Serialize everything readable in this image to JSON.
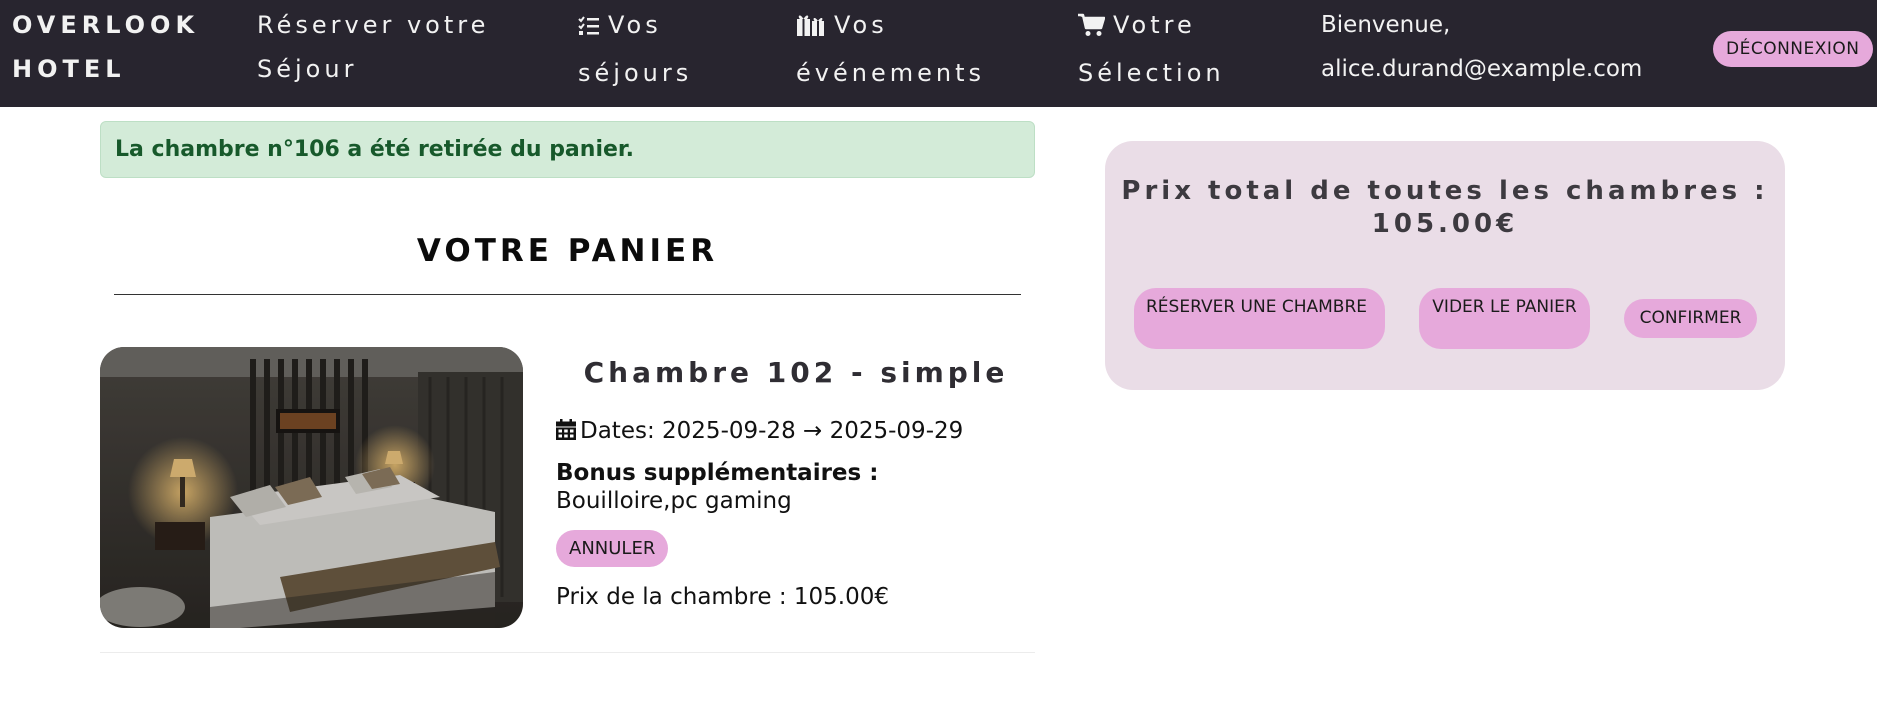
{
  "navbar": {
    "brand": {
      "line1": "OVERLOOK",
      "line2": "HOTEL"
    },
    "reserve": {
      "line1": "Réserver votre",
      "line2": "Séjour"
    },
    "stays": {
      "icon": "checklist-icon",
      "line1": "Vos",
      "line2": "séjours"
    },
    "events": {
      "icon": "gift-icon",
      "line1": "Vos",
      "line2": "événements"
    },
    "selection": {
      "icon": "cart-icon",
      "line1": "Votre",
      "line2": "Sélection"
    },
    "welcome": {
      "line1": "Bienvenue,",
      "line2": "alice.durand@example.com"
    },
    "logout_label": "DÉCONNEXION"
  },
  "alert": {
    "message": "La chambre n°106 a été retirée du panier."
  },
  "cart": {
    "title": "VOTRE PANIER",
    "items": [
      {
        "name": "Chambre 102 - simple",
        "dates_label": "Dates:",
        "dates_value": "2025-09-28 → 2025-09-29",
        "bonus_label": "Bonus supplémentaires :",
        "bonus_value": "Bouilloire,pc gaming",
        "cancel_label": "ANNULER",
        "price_text": "Prix de la chambre : 105.00€"
      }
    ]
  },
  "summary": {
    "title_line1": "Prix total de toutes les chambres :",
    "title_line2": "105.00€",
    "reserve_label": "RÉSERVER UNE CHAMBRE",
    "empty_label": "VIDER LE PANIER",
    "confirm_label": "CONFIRMER"
  },
  "colors": {
    "navbar_bg": "#28252f",
    "button_pink": "#e6a9db",
    "alert_bg": "#d3ebd8",
    "alert_text": "#17592b",
    "summary_bg": "#eadde7"
  }
}
